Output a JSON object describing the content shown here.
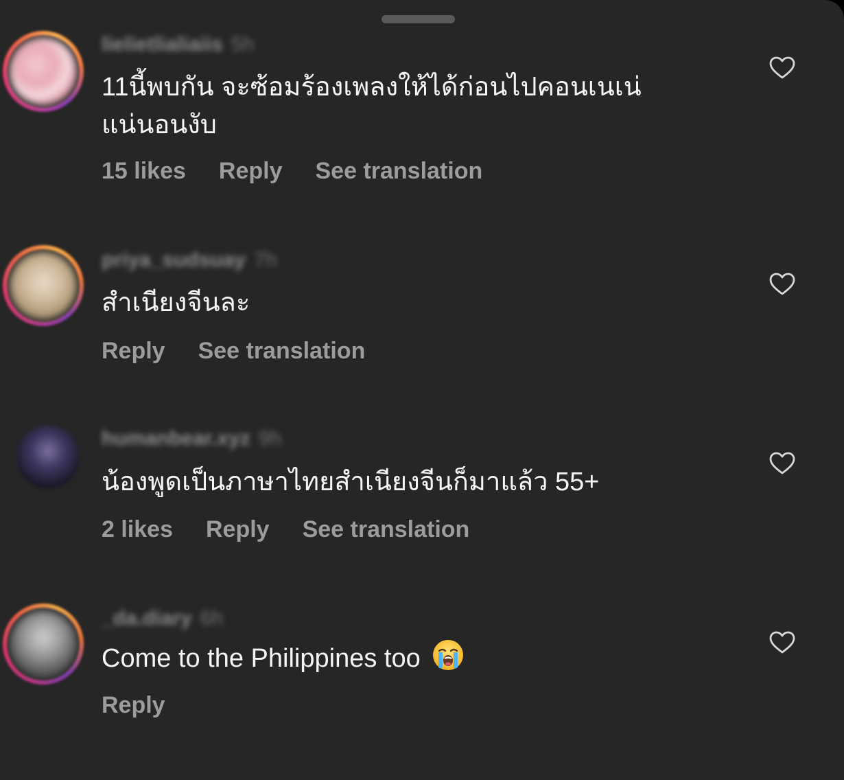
{
  "sheet": {
    "grabber_icon": "drag-handle"
  },
  "comments": [
    {
      "username": "lielietlialiaiis",
      "time": "5h",
      "text": "11นี้พบกัน จะซ้อมร้องเพลงให้ได้ก่อนไปคอนเนเน่แน่นอนงับ",
      "likes": "15 likes",
      "reply": "Reply",
      "see_translation": "See translation"
    },
    {
      "username": "priya_sudsuay",
      "time": "7h",
      "text": "สำเนียงจีนละ",
      "reply": "Reply",
      "see_translation": "See translation"
    },
    {
      "username": "humanbear.xyz",
      "time": "9h",
      "text": "น้องพูดเป็นภาษาไทยสำเนียงจีนก็มาแล้ว 55+",
      "likes": "2 likes",
      "reply": "Reply",
      "see_translation": "See translation"
    },
    {
      "username": "_da.diary",
      "time": "6h",
      "text": "Come to the Philippines too",
      "emoji": "loudly-crying-face-emoji",
      "reply": "Reply"
    }
  ],
  "colors": {
    "background": "#262626",
    "text": "#f5f5f5",
    "secondary": "#9c9c9c"
  }
}
